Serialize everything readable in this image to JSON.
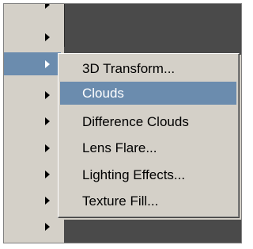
{
  "menu": {
    "items": [
      {
        "label": "3D Transform..."
      },
      {
        "label": "Clouds"
      },
      {
        "label": "Difference Clouds"
      },
      {
        "label": "Lens Flare..."
      },
      {
        "label": "Lighting Effects..."
      },
      {
        "label": "Texture Fill..."
      }
    ],
    "highlighted_index": 1
  },
  "parent_menu": {
    "selected_index": 2
  },
  "colors": {
    "highlight": "#6b8cae",
    "menu_bg": "#d4d0c8",
    "dark_bg": "#4a4a4a"
  }
}
